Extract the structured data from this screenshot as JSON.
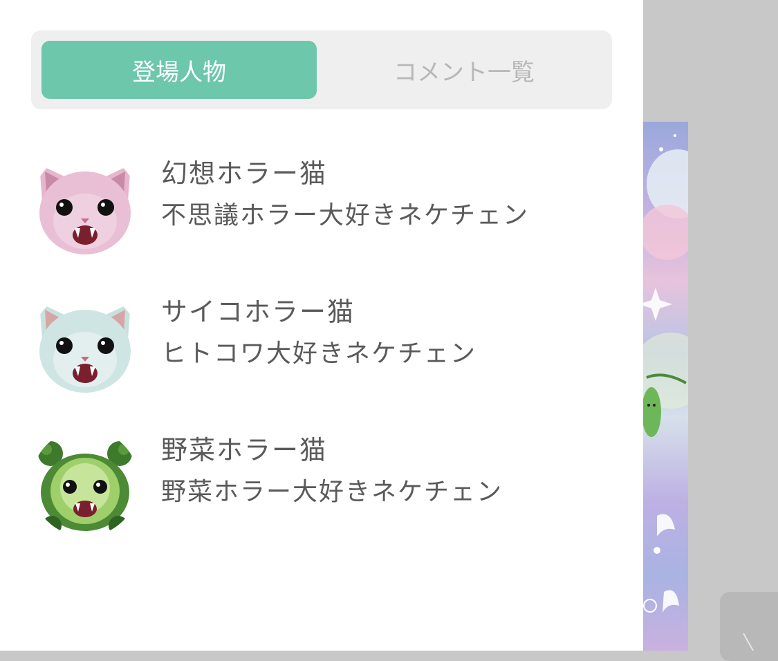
{
  "tabs": {
    "characters": "登場人物",
    "comments": "コメント一覧"
  },
  "characters": [
    {
      "name": "幻想ホラー猫",
      "subtitle": "不思議ホラー大好きネケチェン",
      "avatar": "pink-cat-icon"
    },
    {
      "name": "サイコホラー猫",
      "subtitle": "ヒトコワ大好きネケチェン",
      "avatar": "mint-cat-icon"
    },
    {
      "name": "野菜ホラー猫",
      "subtitle": "野菜ホラー大好きネケチェン",
      "avatar": "vegetable-cat-icon"
    }
  ],
  "colors": {
    "accent": "#6cc7ab",
    "tab_bar": "#efefef",
    "text": "#5a5a5a",
    "inactive_tab_text": "#b7b7b7",
    "backdrop": "#c8c8c8"
  }
}
